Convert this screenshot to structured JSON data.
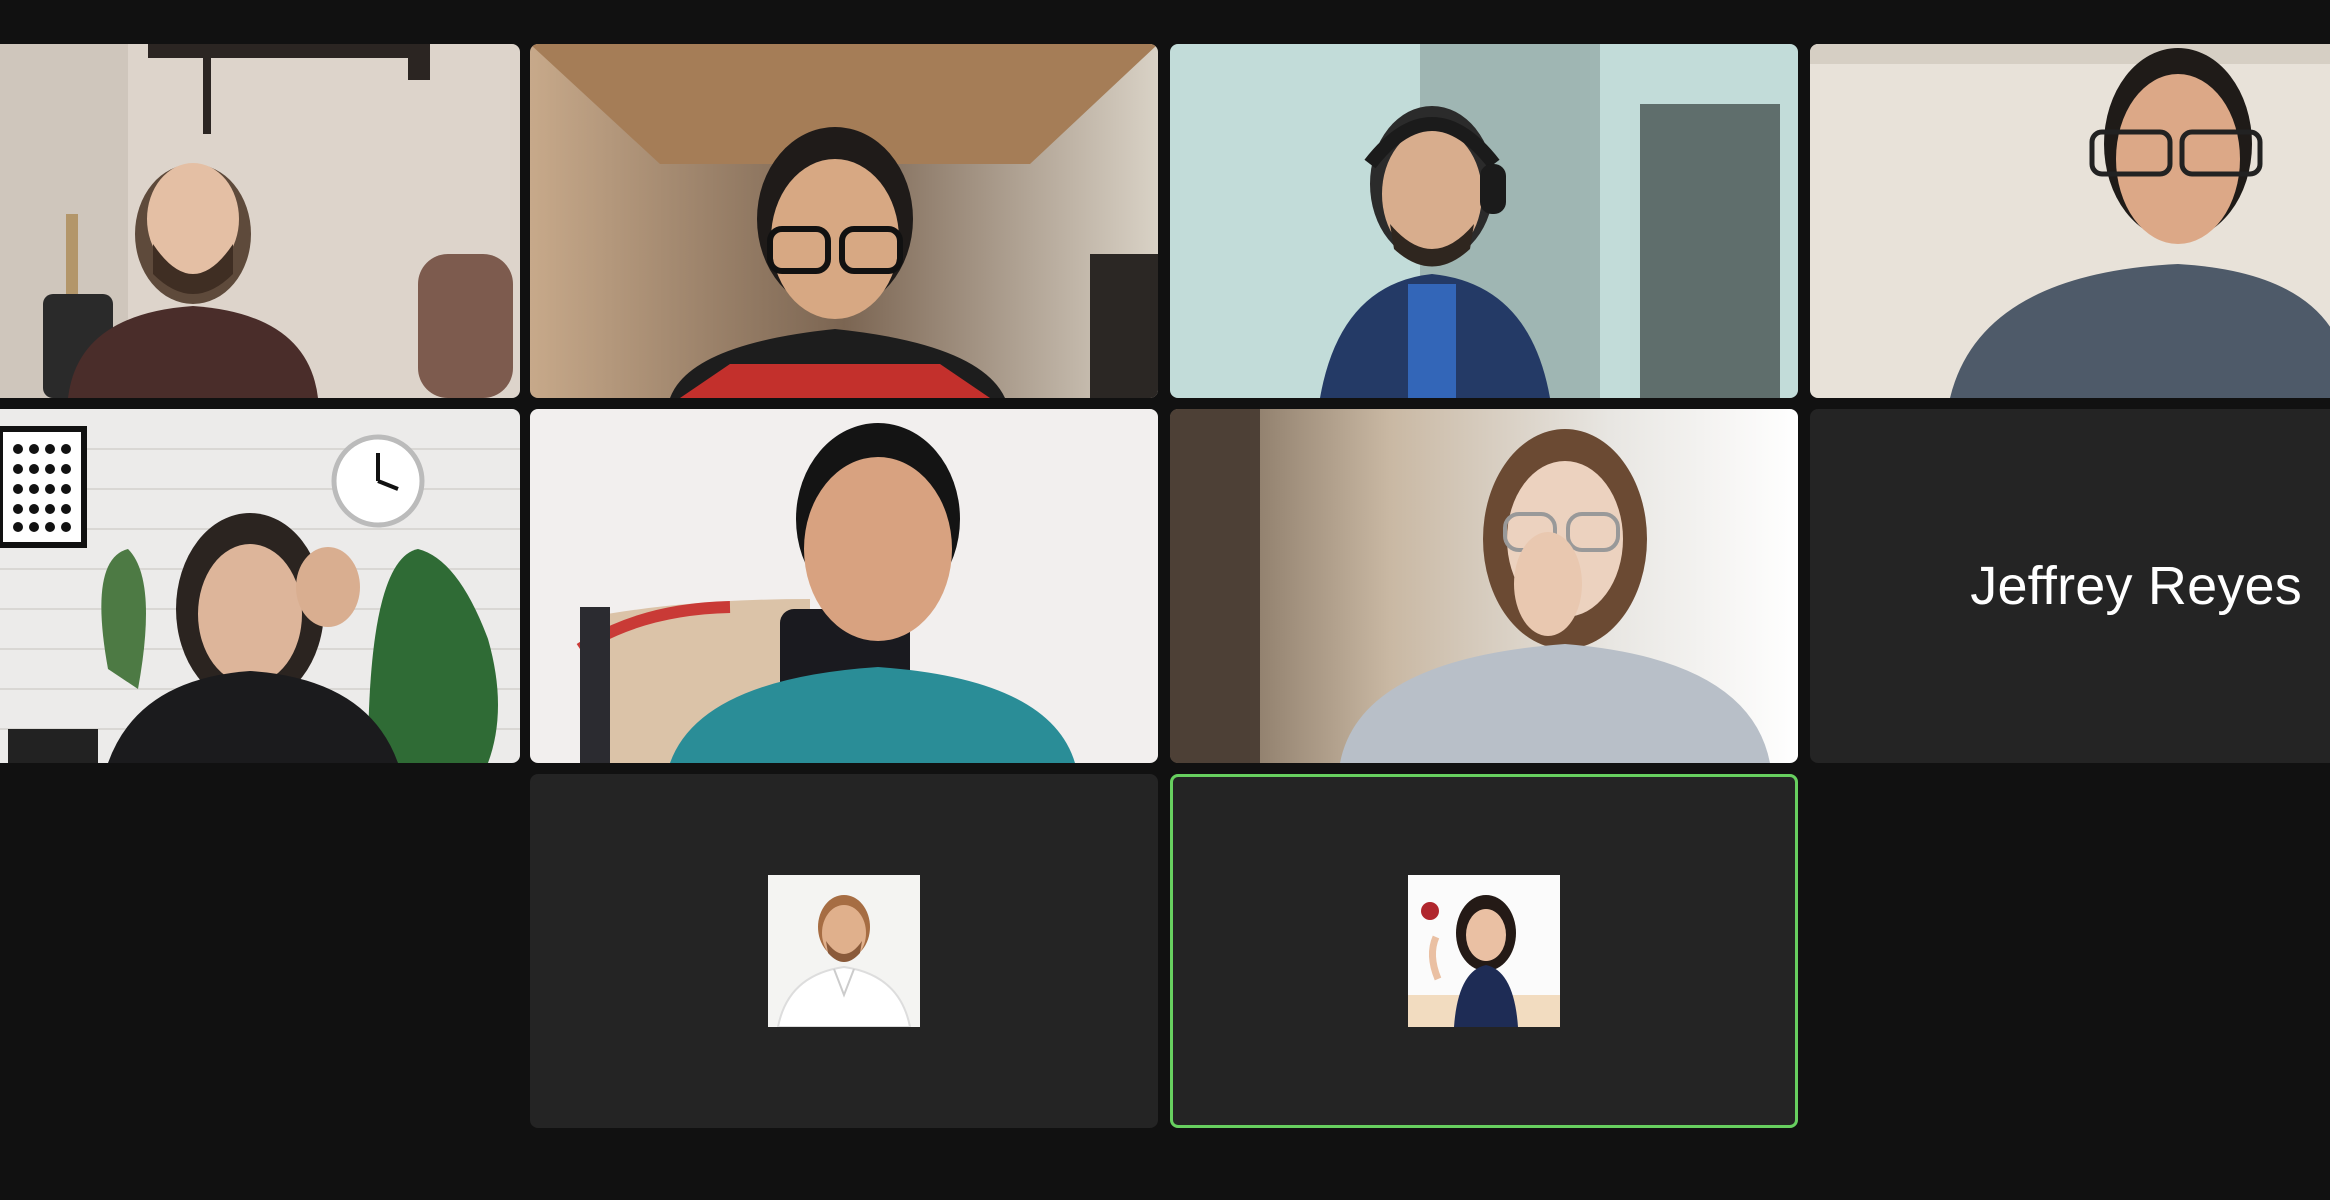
{
  "meeting": {
    "view": "gallery",
    "participants": [
      {
        "tile": "video",
        "state": "camera-on"
      },
      {
        "tile": "video",
        "state": "camera-on"
      },
      {
        "tile": "video",
        "state": "camera-on",
        "headphones": true
      },
      {
        "tile": "video",
        "state": "camera-on"
      },
      {
        "tile": "video",
        "state": "camera-on"
      },
      {
        "tile": "video",
        "state": "camera-on"
      },
      {
        "tile": "video",
        "state": "camera-on"
      },
      {
        "tile": "name",
        "state": "camera-off",
        "name": "Jeffrey Reyes"
      },
      {
        "tile": "avatar",
        "state": "camera-off"
      },
      {
        "tile": "avatar",
        "state": "camera-off",
        "active_speaker": true
      }
    ]
  },
  "theme": {
    "background": "#111111",
    "tile_background": "#242424",
    "active_speaker_border": "#67cf5f",
    "name_text": "#ffffff"
  },
  "icons": {
    "avatar": "profile-photo"
  }
}
